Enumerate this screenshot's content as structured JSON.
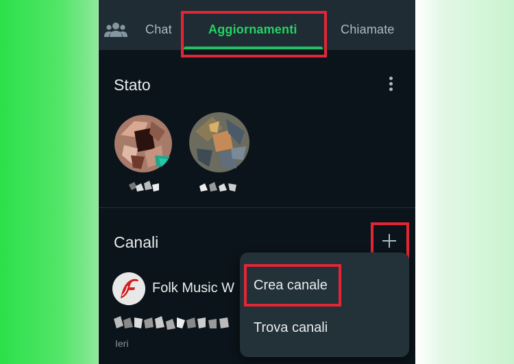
{
  "tabs": {
    "community_icon": "community-icon",
    "chat": "Chat",
    "updates": "Aggiornamenti",
    "calls": "Chiamate"
  },
  "status": {
    "title": "Stato",
    "menu_icon": "more-vert-icon"
  },
  "channels": {
    "title": "Canali",
    "add_icon": "plus-icon",
    "items": [
      {
        "name": "Folk Music W",
        "time": "Ieri"
      }
    ]
  },
  "popup_menu": {
    "items": [
      "Crea canale",
      "Trova canali"
    ]
  },
  "colors": {
    "accent": "#25d366",
    "highlight": "#e32636",
    "background": "#0b141a",
    "surface": "#1f2c33"
  }
}
